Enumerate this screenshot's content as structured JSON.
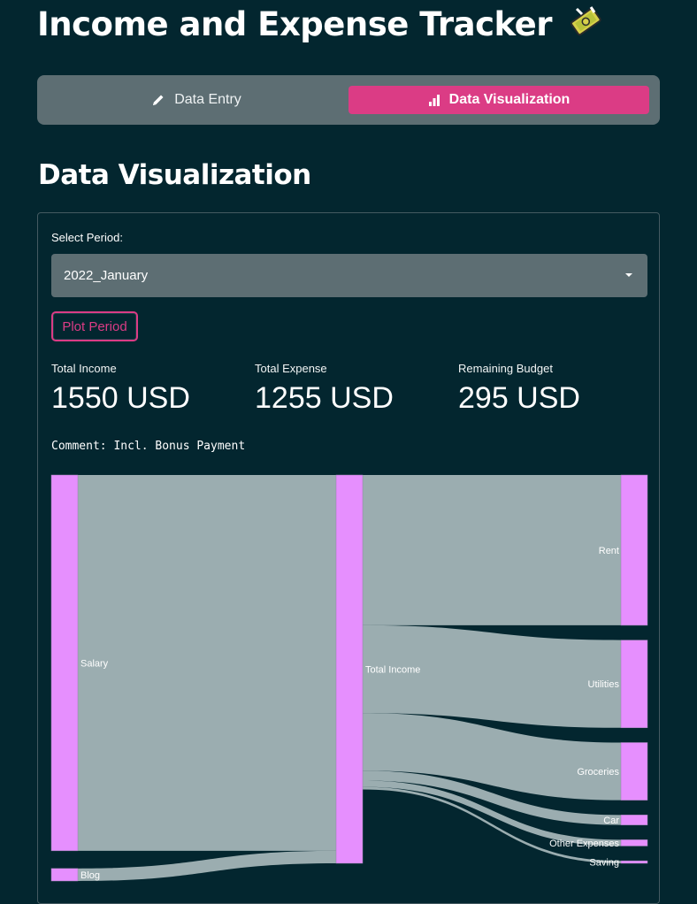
{
  "app": {
    "title": "Income and Expense Tracker",
    "title_icon": "money-with-wings-emoji"
  },
  "tabs": [
    {
      "label": "Data Entry",
      "icon": "pencil-icon",
      "active": false
    },
    {
      "label": "Data Visualization",
      "icon": "bar-chart-icon",
      "active": true
    }
  ],
  "section": {
    "title": "Data Visualization"
  },
  "period": {
    "label": "Select Period:",
    "value": "2022_January"
  },
  "plot_button": {
    "label": "Plot Period"
  },
  "metrics": [
    {
      "label": "Total Income",
      "value": "1550 USD"
    },
    {
      "label": "Total Expense",
      "value": "1255 USD"
    },
    {
      "label": "Remaining Budget",
      "value": "295 USD"
    }
  ],
  "comment": "Comment: Incl. Bonus Payment",
  "colors": {
    "accent": "#db3c85",
    "background": "#03262f",
    "tabbar": "#5d6e73",
    "node": "#e68ffe",
    "link": "#a3b4b7"
  },
  "chart_data": {
    "type": "sankey",
    "unit": "USD",
    "nodes": [
      "Salary",
      "Blog",
      "Total Income",
      "Rent",
      "Utilities",
      "Groceries",
      "Car",
      "Other Expenses",
      "Saving"
    ],
    "links": [
      {
        "source": "Salary",
        "target": "Total Income",
        "value": 1500
      },
      {
        "source": "Blog",
        "target": "Total Income",
        "value": 50
      },
      {
        "source": "Total Income",
        "target": "Rent",
        "value": 600
      },
      {
        "source": "Total Income",
        "target": "Utilities",
        "value": 350
      },
      {
        "source": "Total Income",
        "target": "Groceries",
        "value": 230
      },
      {
        "source": "Total Income",
        "target": "Car",
        "value": 40
      },
      {
        "source": "Total Income",
        "target": "Other Expenses",
        "value": 25
      },
      {
        "source": "Total Income",
        "target": "Saving",
        "value": 10
      }
    ]
  }
}
